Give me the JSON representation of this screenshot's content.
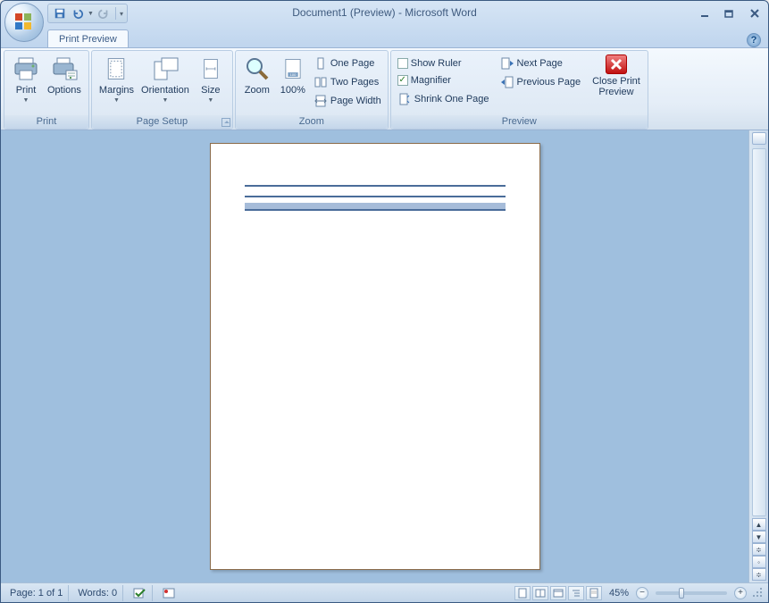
{
  "title": {
    "doc": "Document1 (Preview)",
    "app": "Microsoft Word"
  },
  "tab": {
    "print_preview": "Print Preview"
  },
  "ribbon": {
    "print": {
      "print": "Print",
      "options": "Options",
      "group": "Print"
    },
    "page_setup": {
      "margins": "Margins",
      "orientation": "Orientation",
      "size": "Size",
      "group": "Page Setup"
    },
    "zoom": {
      "zoom": "Zoom",
      "hundred": "100%",
      "one_page": "One Page",
      "two_pages": "Two Pages",
      "page_width": "Page Width",
      "group": "Zoom"
    },
    "preview": {
      "show_ruler": "Show Ruler",
      "magnifier": "Magnifier",
      "shrink": "Shrink One Page",
      "next": "Next Page",
      "prev": "Previous Page",
      "close1": "Close Print",
      "close2": "Preview",
      "group": "Preview",
      "show_ruler_checked": false,
      "magnifier_checked": true
    }
  },
  "status": {
    "page": "Page: 1 of 1",
    "words": "Words: 0",
    "zoom": "45%"
  }
}
